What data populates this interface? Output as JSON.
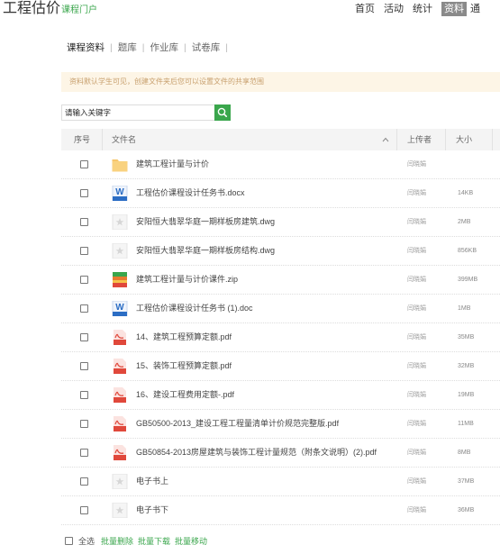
{
  "header": {
    "title": "工程估价",
    "subtitle": "课程门户",
    "nav": [
      "首页",
      "活动",
      "统计",
      "资料",
      "通"
    ],
    "active_nav": "资料"
  },
  "tabs": [
    "课程资料",
    "题库",
    "作业库",
    "试卷库"
  ],
  "notice": "资料默认学生可见，创建文件夹后您可以设置文件的共享范围",
  "search": {
    "placeholder": "请输入关键字"
  },
  "table": {
    "headers": {
      "index": "序号",
      "filename": "文件名",
      "uploader": "上传者",
      "size": "大小"
    },
    "rows": [
      {
        "name": "建筑工程计量与计价",
        "icon": "folder-icon",
        "uploader": "闫晓娟",
        "size": ""
      },
      {
        "name": "工程估价课程设计任务书.docx",
        "icon": "word-icon",
        "uploader": "闫晓娟",
        "size": "14KB"
      },
      {
        "name": "安阳恒大翡翠华庭一期样板房建筑.dwg",
        "icon": "star-file-icon",
        "uploader": "闫晓娟",
        "size": "2MB"
      },
      {
        "name": "安阳恒大翡翠华庭一期样板房结构.dwg",
        "icon": "star-file-icon",
        "uploader": "闫晓娟",
        "size": "856KB"
      },
      {
        "name": "建筑工程计量与计价课件.zip",
        "icon": "zip-icon",
        "uploader": "闫晓娟",
        "size": "399MB"
      },
      {
        "name": "工程估价课程设计任务书 (1).doc",
        "icon": "word-icon",
        "uploader": "闫晓娟",
        "size": "1MB"
      },
      {
        "name": "14、建筑工程预算定额.pdf",
        "icon": "pdf-icon",
        "uploader": "闫晓娟",
        "size": "35MB"
      },
      {
        "name": "15、装饰工程预算定额.pdf",
        "icon": "pdf-icon",
        "uploader": "闫晓娟",
        "size": "32MB"
      },
      {
        "name": "16、建设工程费用定额-.pdf",
        "icon": "pdf-icon",
        "uploader": "闫晓娟",
        "size": "19MB"
      },
      {
        "name": "GB50500-2013_建设工程工程量清单计价规范完整版.pdf",
        "icon": "pdf-icon",
        "uploader": "闫晓娟",
        "size": "11MB"
      },
      {
        "name": "GB50854-2013房屋建筑与装饰工程计量规范（附条文说明）(2).pdf",
        "icon": "pdf-icon",
        "uploader": "闫晓娟",
        "size": "8MB"
      },
      {
        "name": "电子书上",
        "icon": "star-file-icon",
        "uploader": "闫晓娟",
        "size": "37MB"
      },
      {
        "name": "电子书下",
        "icon": "star-file-icon",
        "uploader": "闫晓娟",
        "size": "36MB"
      }
    ]
  },
  "footer": {
    "select_all": "全选",
    "actions": [
      "批量删除",
      "批量下载",
      "批量移动"
    ]
  },
  "colors": {
    "accent_green": "#3aa64c",
    "notice_bg": "#fdf5e6",
    "notice_text": "#c8a06e",
    "folder": "#f7c66b",
    "word": "#2b6dc4",
    "pdf": "#e0483b",
    "zip": "#e87b2f"
  }
}
